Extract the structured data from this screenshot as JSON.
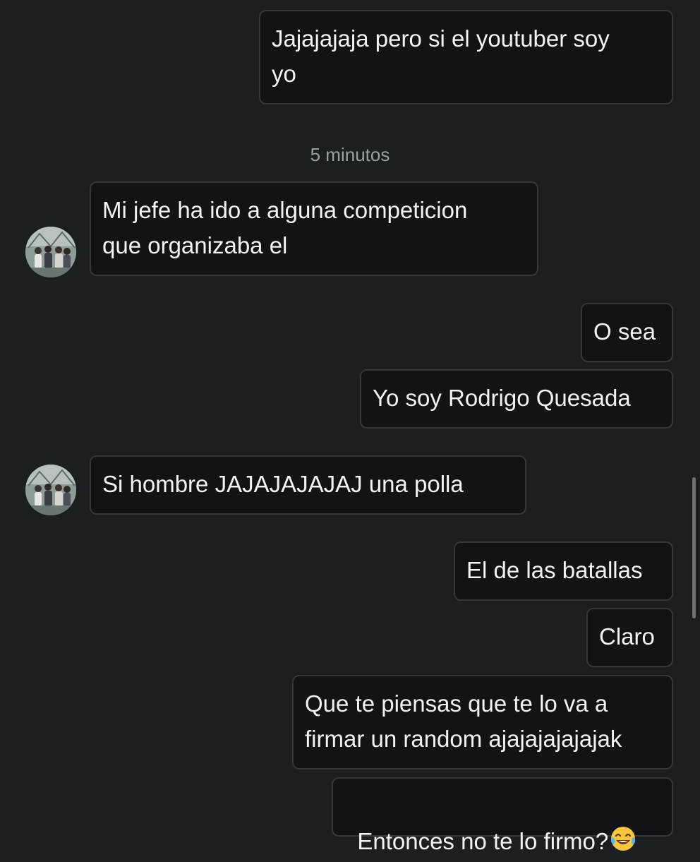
{
  "conversation": {
    "timestamp": "5 minutos",
    "messages": [
      {
        "direction": "sent",
        "text": "Jajajajaja pero si el youtuber soy\nyo"
      },
      {
        "direction": "received",
        "text": "Mi jefe ha ido a alguna competicion\nque organizaba el"
      },
      {
        "direction": "sent",
        "text": "O sea"
      },
      {
        "direction": "sent",
        "text": "Yo soy Rodrigo Quesada"
      },
      {
        "direction": "received",
        "text": "Si hombre JAJAJAJAJAJ una polla"
      },
      {
        "direction": "sent",
        "text": "El de las batallas"
      },
      {
        "direction": "sent",
        "text": "Claro"
      },
      {
        "direction": "sent",
        "text": "Que te piensas que te lo va a\nfirmar un random ajajajajajajak"
      },
      {
        "direction": "sent",
        "text": "Entonces no te lo firmo?",
        "emoji": "face-with-tears-of-joy-icon"
      }
    ]
  },
  "colors": {
    "background": "#1b1f20",
    "bubble_fill": "#111314",
    "bubble_border": "#34383a",
    "timestamp_text": "#9a9fa2"
  }
}
